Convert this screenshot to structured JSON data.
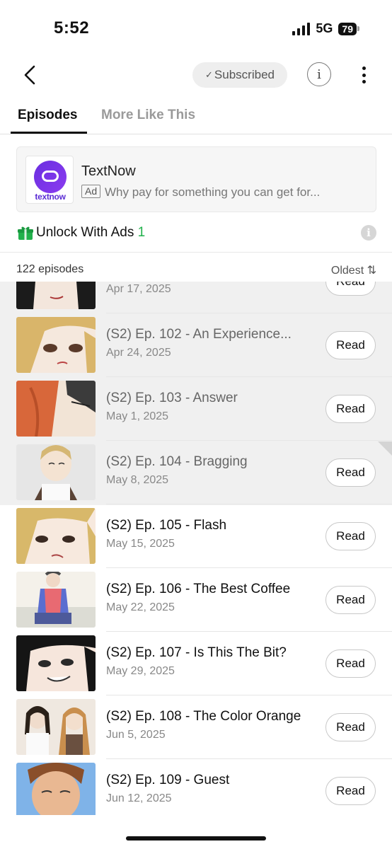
{
  "status": {
    "time": "5:52",
    "network": "5G",
    "battery": "79"
  },
  "nav": {
    "subscribed_label": "Subscribed",
    "info_label": "i"
  },
  "tabs": {
    "episodes": "Episodes",
    "more_like_this": "More Like This"
  },
  "ad": {
    "title": "TextNow",
    "badge": "Ad",
    "description": "Why pay for something you can get for...",
    "logo_text": "textnow",
    "brand_color": "#7b35e8"
  },
  "unlock": {
    "label": "Unlock With Ads",
    "count": "1"
  },
  "episodes_header": {
    "count": "122 episodes",
    "sort": "Oldest ⇅"
  },
  "episodes": [
    {
      "title": "",
      "date": "Apr 17, 2025",
      "button": "Read",
      "state": "read"
    },
    {
      "title": "(S2) Ep. 102 - An Experience...",
      "date": "Apr 24, 2025",
      "button": "Read",
      "state": "read"
    },
    {
      "title": "(S2) Ep. 103 - Answer",
      "date": "May 1, 2025",
      "button": "Read",
      "state": "read"
    },
    {
      "title": "(S2) Ep. 104 - Bragging",
      "date": "May 8, 2025",
      "button": "Read",
      "state": "read"
    },
    {
      "title": "(S2) Ep. 105 - Flash",
      "date": "May 15, 2025",
      "button": "Read",
      "state": "unread"
    },
    {
      "title": "(S2) Ep. 106 - The Best Coffee",
      "date": "May 22, 2025",
      "button": "Read",
      "state": "unread"
    },
    {
      "title": "(S2) Ep. 107 - Is This The Bit?",
      "date": "May 29, 2025",
      "button": "Read",
      "state": "unread"
    },
    {
      "title": "(S2) Ep. 108 - The Color Orange",
      "date": "Jun 5, 2025",
      "button": "Read",
      "state": "unread"
    },
    {
      "title": "(S2) Ep. 109 - Guest",
      "date": "Jun 12, 2025",
      "button": "Read",
      "state": "unread"
    }
  ],
  "colors": {
    "accent_green": "#22b14c",
    "read_shade": "#f0f0f0"
  }
}
